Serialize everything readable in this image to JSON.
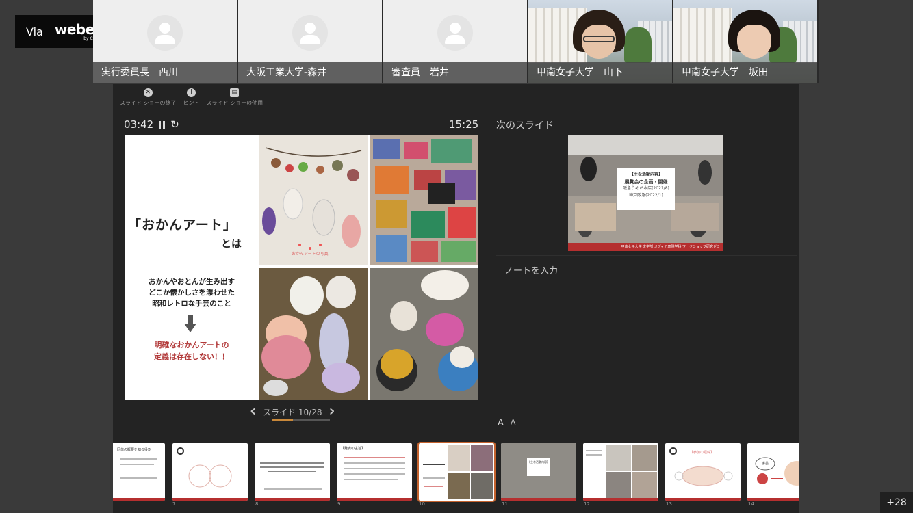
{
  "badge": {
    "via": "Via",
    "brand": "webex",
    "by": "by CISCO"
  },
  "participants": [
    {
      "name": "実行委員長　西川",
      "video": false
    },
    {
      "name": "大阪工業大学-森井",
      "video": false
    },
    {
      "name": "審査員　岩井",
      "video": false
    },
    {
      "name": "甲南女子大学　山下",
      "video": true
    },
    {
      "name": "甲南女子大学　坂田",
      "video": true
    }
  ],
  "toolbar": {
    "end_show": "スライド ショーの終了",
    "hint": "ヒント",
    "use_show": "スライド ショーの使用"
  },
  "timer": {
    "elapsed": "03:42",
    "clock": "15:25"
  },
  "next_slide": {
    "label": "次のスライド",
    "card_title": "【主な活動内容】",
    "card_sub": "展覧会の企画・開催",
    "card_l1": "阪急うめだ本店(2021/8)",
    "card_l2": "神戸阪急(2022/1)",
    "footer": "甲南女子大学 文学部 メディア表現学科 ワークショップ研究ゼミ"
  },
  "slide": {
    "title": "「おかんアート」",
    "toha": "とは",
    "desc_1": "おかんやおとんが生み出す",
    "desc_2": "どこか懐かしさを漂わせた",
    "desc_3": "昭和レトロな手芸のこと",
    "note_1": "明確なおかんアートの",
    "note_2": "定義は存在しない！！",
    "photo_caption": "おかんアートの写真"
  },
  "slide_nav": {
    "counter": "スライド 10/28",
    "progress": 0.357
  },
  "notes": {
    "placeholder": "ノートを入力"
  },
  "font_buttons": {
    "increase": "A",
    "decrease": "A"
  },
  "thumbnails": {
    "numbers": [
      "7",
      "8",
      "9",
      "10",
      "11",
      "12",
      "13",
      "14"
    ],
    "t1_title": "団体の概要を知る役割",
    "t4_title": "【発表の主旨】",
    "t6_title": "【主な活動内容】",
    "t9_title": "【参加の経緯】",
    "t10_speech": "手芸"
  },
  "more_participants": "+28",
  "colors": {
    "accent": "#c4622d",
    "brand_red": "#b52f2f",
    "progress": "#c8883a"
  }
}
